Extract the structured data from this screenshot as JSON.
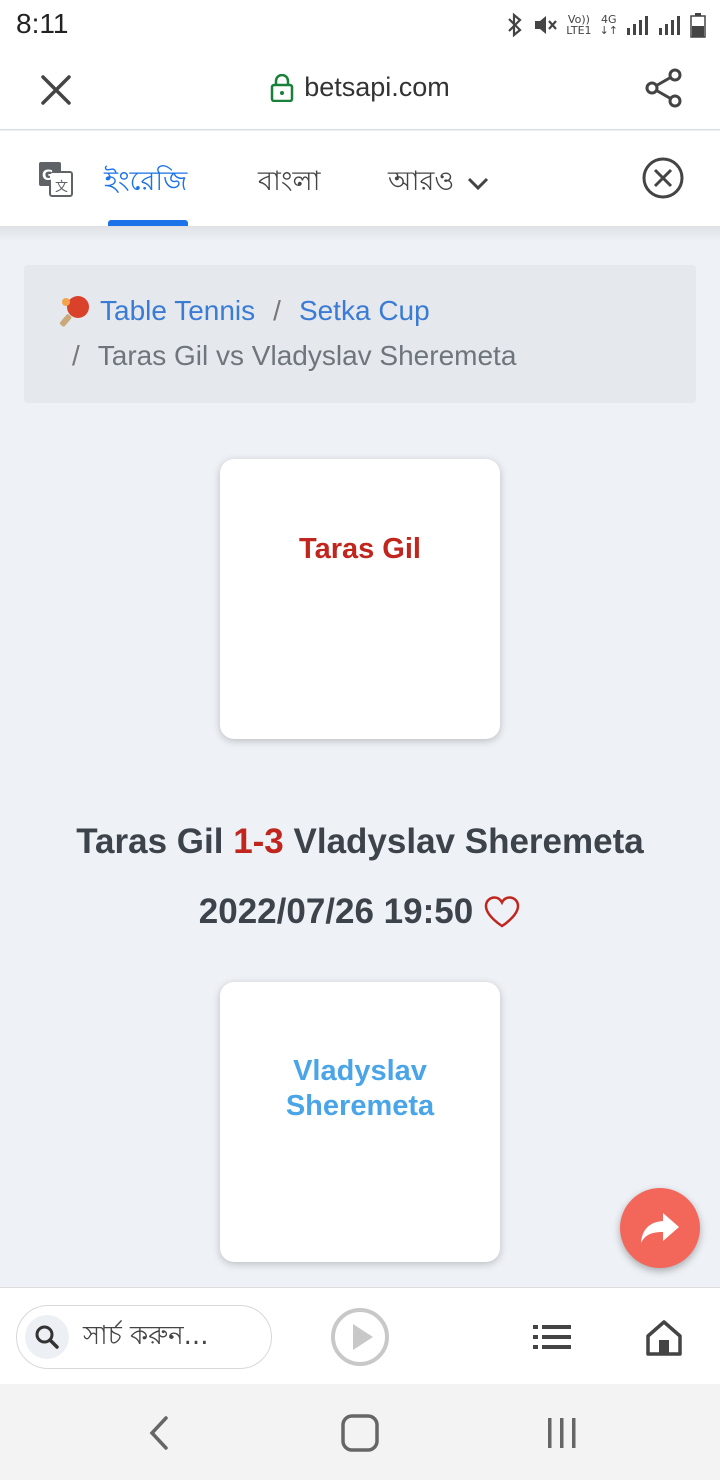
{
  "status_bar": {
    "time": "8:11",
    "network_top": "Vo))",
    "network_bottom": "LTE1",
    "signal_label": "4G"
  },
  "browser": {
    "url": "betsapi.com",
    "close_icon": "close-icon",
    "share_icon": "share-icon",
    "lock_icon": "lock-icon"
  },
  "translate_bar": {
    "tabs": [
      "ইংরেজি",
      "বাংলা"
    ],
    "active_tab": "ইংরেজি",
    "more_label": "আরও",
    "icon": "google-translate-icon"
  },
  "breadcrumb": {
    "sport": "Table Tennis",
    "league": "Setka Cup",
    "sep": "/",
    "current": "Taras Gil vs Vladyslav Sheremeta"
  },
  "match": {
    "home": "Taras Gil",
    "away_line1": "Vladyslav",
    "away_line2": "Sheremeta",
    "away_full": "Vladyslav Sheremeta",
    "score": "1-3",
    "datetime": "2022/07/26 19:50"
  },
  "bottom_bar": {
    "search_placeholder": "সার্চ করুন..."
  },
  "colors": {
    "accent_blue": "#1a73e8",
    "link_blue": "#3a7bd5",
    "home_red": "#c0261e",
    "away_blue": "#4aa5e8",
    "fab": "#f2675a"
  }
}
